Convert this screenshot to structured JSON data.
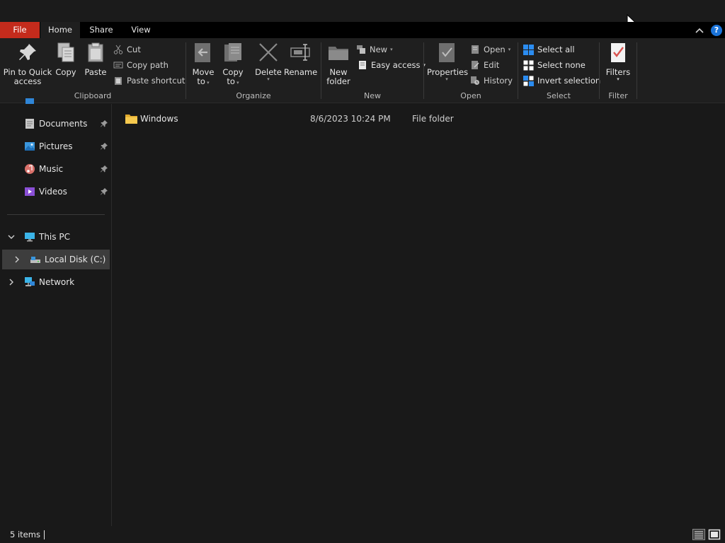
{
  "tabs": {
    "file": "File",
    "home": "Home",
    "share": "Share",
    "view": "View",
    "help": "?"
  },
  "ribbon": {
    "clipboard": {
      "label": "Clipboard",
      "pin_line1": "Pin to Quick",
      "pin_line2": "access",
      "copy": "Copy",
      "paste": "Paste",
      "cut": "Cut",
      "copy_path": "Copy path",
      "paste_shortcut": "Paste shortcut"
    },
    "organize": {
      "label": "Organize",
      "move_line1": "Move",
      "move_line2": "to",
      "copy_line1": "Copy",
      "copy_line2": "to",
      "delete": "Delete",
      "rename": "Rename"
    },
    "new": {
      "label": "New",
      "folder_line1": "New",
      "folder_line2": "folder",
      "new_item": "New",
      "easy_access": "Easy access"
    },
    "open": {
      "label": "Open",
      "properties": "Properties",
      "open": "Open",
      "edit": "Edit",
      "history": "History"
    },
    "select": {
      "label": "Select",
      "select_all": "Select all",
      "select_none": "Select none",
      "invert": "Invert selection"
    },
    "filter": {
      "label": "Filter",
      "filters": "Filters"
    }
  },
  "nav": {
    "items": [
      {
        "label": "Documents"
      },
      {
        "label": "Pictures"
      },
      {
        "label": "Music"
      },
      {
        "label": "Videos"
      },
      {
        "label": "This PC"
      },
      {
        "label": "Local Disk (C:)"
      },
      {
        "label": "Network"
      }
    ]
  },
  "files": [
    {
      "name": "Windows",
      "date": "8/6/2023 10:24 PM",
      "type": "File folder"
    }
  ],
  "status": {
    "count": "5 items"
  },
  "colors": {
    "file_tab": "#c42b1c",
    "accent": "#1a73d9",
    "background": "#191919",
    "ribbon": "#1f1f1f"
  }
}
